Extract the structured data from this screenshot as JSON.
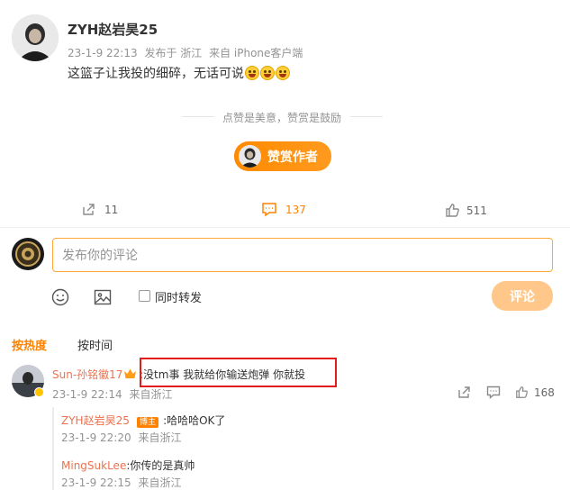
{
  "post": {
    "author_name": "ZYH赵岩昊25",
    "time": "23-1-9 22:13",
    "location": "发布于 浙江",
    "source": "来自 iPhone客户端",
    "text": "这篮子让我投的细碎，无话可说",
    "emoji_count": 3
  },
  "reward": {
    "slogan": "点赞是美意，赞赏是鼓励",
    "button_label": "赞赏作者"
  },
  "actions": {
    "repost_count": "11",
    "comment_count": "137",
    "like_count": "511"
  },
  "composer": {
    "placeholder": "发布你的评论",
    "repost_label": "同时转发",
    "submit_label": "评论"
  },
  "sort": {
    "hot_label": "按热度",
    "time_label": "按时间"
  },
  "comments": [
    {
      "name": "Sun-孙铭徽17",
      "text": ":没tm事 我就给你输送炮弹 你就投",
      "time": "23-1-9 22:14",
      "source": "来自浙江",
      "like_count": "168",
      "replies": [
        {
          "name": "ZYH赵岩昊25",
          "badge": "博主",
          "text": ":哈哈哈OK了",
          "time": "23-1-9 22:20",
          "source": "来自浙江"
        },
        {
          "name": "MingSukLee",
          "text": ":你传的是真帅",
          "time": "23-1-9 22:15",
          "source": "来自浙江"
        }
      ]
    }
  ],
  "colors": {
    "accent": "#ff8200",
    "highlight_box": "#e31b1b",
    "name": "#eb7350"
  }
}
